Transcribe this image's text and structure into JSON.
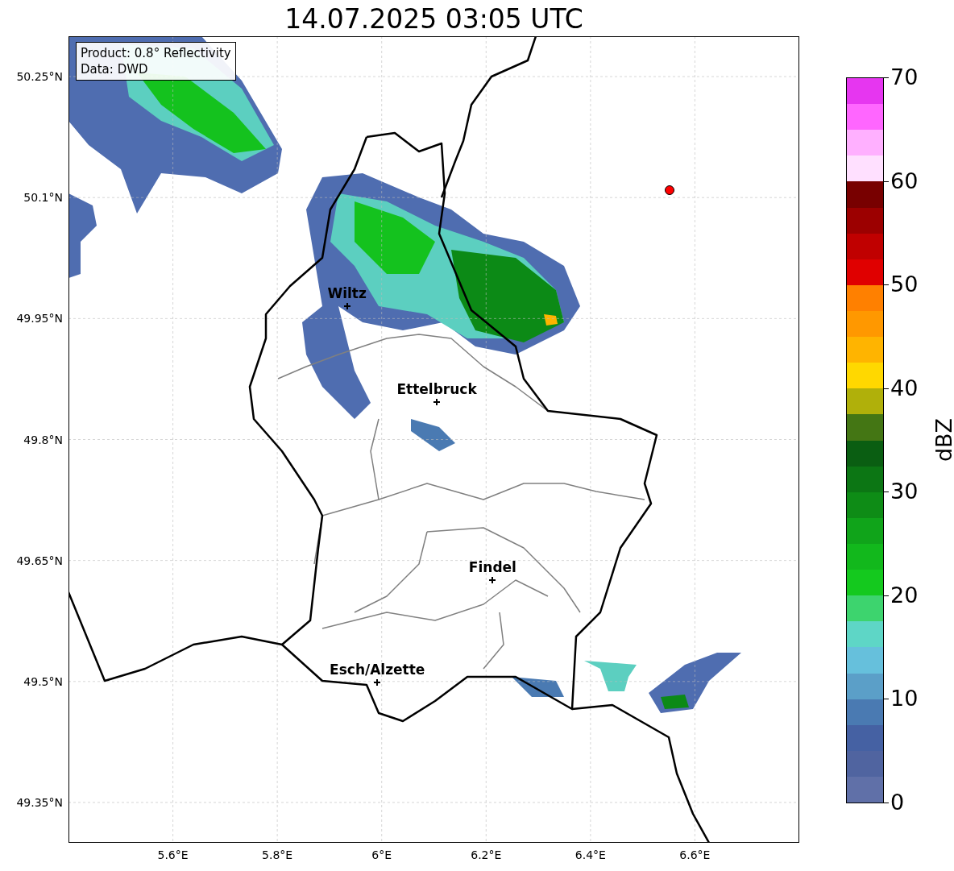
{
  "title": "14.07.2025 03:05 UTC",
  "info_box": {
    "lines": [
      "Product: 0.8° Reflectivity",
      "Data: DWD"
    ]
  },
  "map": {
    "xticks": [
      "5.6°E",
      "5.8°E",
      "6°E",
      "6.2°E",
      "6.4°E",
      "6.6°E"
    ],
    "yticks": [
      "50.25°N",
      "50.1°N",
      "49.95°N",
      "49.8°N",
      "49.65°N",
      "49.5°N",
      "49.35°N"
    ],
    "cities": [
      {
        "name": "Wiltz"
      },
      {
        "name": "Ettelbruck"
      },
      {
        "name": "Findel"
      },
      {
        "name": "Esch/Alzette"
      }
    ],
    "markers": [
      {
        "color": "#ff0000"
      }
    ]
  },
  "colorbar": {
    "label": "dBZ",
    "ticks": [
      "70",
      "60",
      "50",
      "40",
      "30",
      "20",
      "10",
      "0"
    ],
    "segments": [
      {
        "color": "#e636f0"
      },
      {
        "color": "#ff66ff"
      },
      {
        "color": "#ffb0ff"
      },
      {
        "color": "#ffe0ff"
      },
      {
        "color": "#780000"
      },
      {
        "color": "#9c0000"
      },
      {
        "color": "#c00000"
      },
      {
        "color": "#e00000"
      },
      {
        "color": "#ff8000"
      },
      {
        "color": "#ff9800"
      },
      {
        "color": "#ffb400"
      },
      {
        "color": "#ffd800"
      },
      {
        "color": "#b0b00a"
      },
      {
        "color": "#447614"
      },
      {
        "color": "#0a5e12"
      },
      {
        "color": "#0c7614"
      },
      {
        "color": "#0e8c16"
      },
      {
        "color": "#10a41a"
      },
      {
        "color": "#12b81c"
      },
      {
        "color": "#14c91e"
      },
      {
        "color": "#3dd46e"
      },
      {
        "color": "#5ed6c6"
      },
      {
        "color": "#66c0dc"
      },
      {
        "color": "#5b9fc8"
      },
      {
        "color": "#4a7ab2"
      },
      {
        "color": "#4561a3"
      },
      {
        "color": "#5064a0"
      },
      {
        "color": "#6070a8"
      }
    ]
  }
}
